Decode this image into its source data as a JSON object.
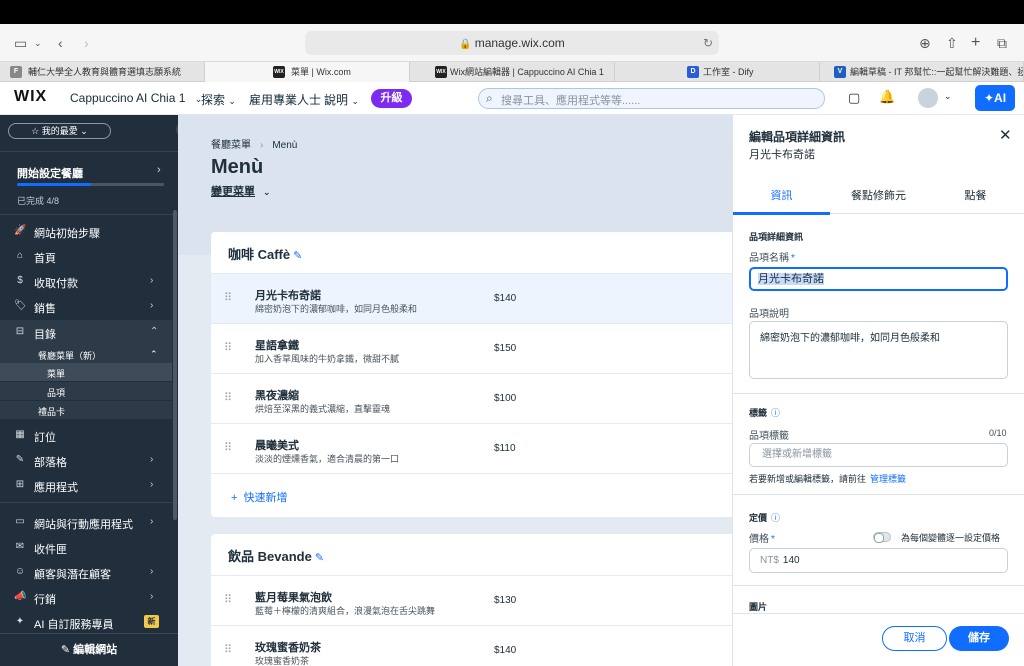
{
  "browser": {
    "url": "manage.wix.com",
    "tabs": [
      {
        "favicon": "F",
        "title": "輔仁大學全人教育與體育選填志願系統"
      },
      {
        "favicon": "WIX",
        "title": "菜單 | Wix.com"
      },
      {
        "favicon": "WIX",
        "title": "Wix網站編輯器 | Cappuccino AI Chia 1"
      },
      {
        "favicon": "D",
        "title": "工作室 - Dify"
      },
      {
        "favicon": "V",
        "title": "編輯草稿 - IT 邦幫忙::一起幫忙解決難題、拯救 IT 人的一天"
      }
    ]
  },
  "header": {
    "logo": "WIX",
    "site_name": "Cappuccino AI Chia 1",
    "nav": [
      "探索",
      "雇用專業人士",
      "說明"
    ],
    "upgrade": "升級",
    "search_placeholder": "搜尋工具、應用程式等等......",
    "ai_label": "AI"
  },
  "sidebar": {
    "favorites": "我的最愛",
    "setup_title": "開始設定餐廳",
    "setup_progress": "已完成 4/8",
    "setup_fraction": 0.5,
    "items": [
      {
        "icon": "🚀",
        "label": "網站初始步驟"
      },
      {
        "icon": "⌂",
        "label": "首頁"
      },
      {
        "icon": "$",
        "label": "收取付款"
      },
      {
        "icon": "🏷",
        "label": "銷售"
      },
      {
        "icon": "⊟",
        "label": "目錄"
      },
      {
        "icon": "▦",
        "label": "訂位"
      },
      {
        "icon": "✎",
        "label": "部落格"
      },
      {
        "icon": "⊞",
        "label": "應用程式"
      },
      {
        "icon": "▭",
        "label": "網站與行動應用程式"
      },
      {
        "icon": "✉",
        "label": "收件匣"
      },
      {
        "icon": "☺",
        "label": "顧客與潛在顧客"
      },
      {
        "icon": "📣",
        "label": "行銷"
      },
      {
        "icon": "✦",
        "label": "AI 自訂服務專員"
      }
    ],
    "catalog_sub": {
      "group": "餐廳菜單（新）",
      "children": [
        "菜單",
        "品項"
      ],
      "gift": "禮品卡"
    },
    "new_badge": "新",
    "edit_site": "編輯網站"
  },
  "main": {
    "breadcrumb": [
      "餐廳菜單",
      "Menù"
    ],
    "title": "Menù",
    "change_menu": "變更菜單",
    "sections": [
      {
        "title": "咖啡 Caffè",
        "items": [
          {
            "name": "月光卡布奇諾",
            "desc": "綿密奶泡下的濃郁咖啡，如同月色般柔和",
            "price": "$140"
          },
          {
            "name": "星語拿鐵",
            "desc": "加入香草風味的牛奶拿鐵，微甜不膩",
            "price": "$150"
          },
          {
            "name": "黑夜濃縮",
            "desc": "烘焙至深黑的義式濃縮，直擊靈魂",
            "price": "$100"
          },
          {
            "name": "晨曦美式",
            "desc": "淡淡的煙燻香氣，適合清晨的第一口",
            "price": "$110"
          }
        ],
        "quick_add": "快速新增"
      },
      {
        "title": "飲品 Bevande",
        "items": [
          {
            "name": "藍月莓果氣泡飲",
            "desc": "藍莓＋檸檬的清爽組合，浪漫氣泡在舌尖跳舞",
            "price": "$130"
          },
          {
            "name": "玫瑰蜜香奶茶",
            "desc": "玫瑰蜜香奶茶",
            "price": "$140"
          }
        ]
      }
    ]
  },
  "panel": {
    "title": "編輯品項詳細資訊",
    "subtitle": "月光卡布奇諾",
    "tabs": [
      "資訊",
      "餐點修飾元",
      "點餐"
    ],
    "details_head": "品項詳細資訊",
    "name_label": "品項名稱",
    "name_value": "月光卡布奇諾",
    "desc_label": "品項說明",
    "desc_value": "綿密奶泡下的濃郁咖啡，如同月色般柔和",
    "tags_head": "標籤",
    "tags_label": "品項標籤",
    "tags_count": "0/10",
    "tags_placeholder": "選擇或新增標籤",
    "tags_note": "若要新增或編輯標籤，請前往",
    "tags_link": "管理標籤",
    "pricing_head": "定價",
    "price_label": "價格",
    "variant_toggle": "為每個變體逐一設定價格",
    "currency": "NT$",
    "price_value": "140",
    "image_head": "圖片",
    "cancel": "取消",
    "save": "儲存"
  }
}
